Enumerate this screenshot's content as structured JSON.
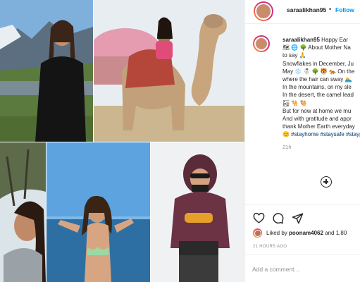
{
  "post": {
    "username": "saraalikhan95",
    "follow_separator": "•",
    "follow_label": "Follow",
    "caption": {
      "username": "saraalikhan95",
      "lines": [
        "Happy Ear",
        "🗺 🌐 🌳 About Mother Na",
        "to say 🙏",
        "Snowflakes in December, Ju",
        "May ❄️ ☃️ 🌳 🐯 🐅 On the",
        "where the hair can sway 🏊",
        "In the mountains, on my sle",
        "In the desert, the camel lead",
        "🏜 🐪 🐫",
        "But for now at home we mu",
        "And with gratitude and appr",
        "thank Mother Earth everyday"
      ],
      "hashtags": "😊 #stayhome #staysafe #stayp",
      "time": "21h"
    },
    "liked_by_prefix": "Liked by ",
    "liked_by_user": "poonam4062",
    "liked_by_suffix": " and 1,80",
    "posted_ago": "21 HOURS AGO",
    "comment_placeholder": "Add a comment..."
  },
  "icons": {
    "heart": "heart-icon",
    "comment": "comment-icon",
    "share": "share-icon",
    "load_more": "plus-circle-icon"
  },
  "colors": {
    "follow": "#0095f6",
    "hashtag": "#00376b",
    "muted": "#8e8e8e",
    "border": "#efefef"
  }
}
